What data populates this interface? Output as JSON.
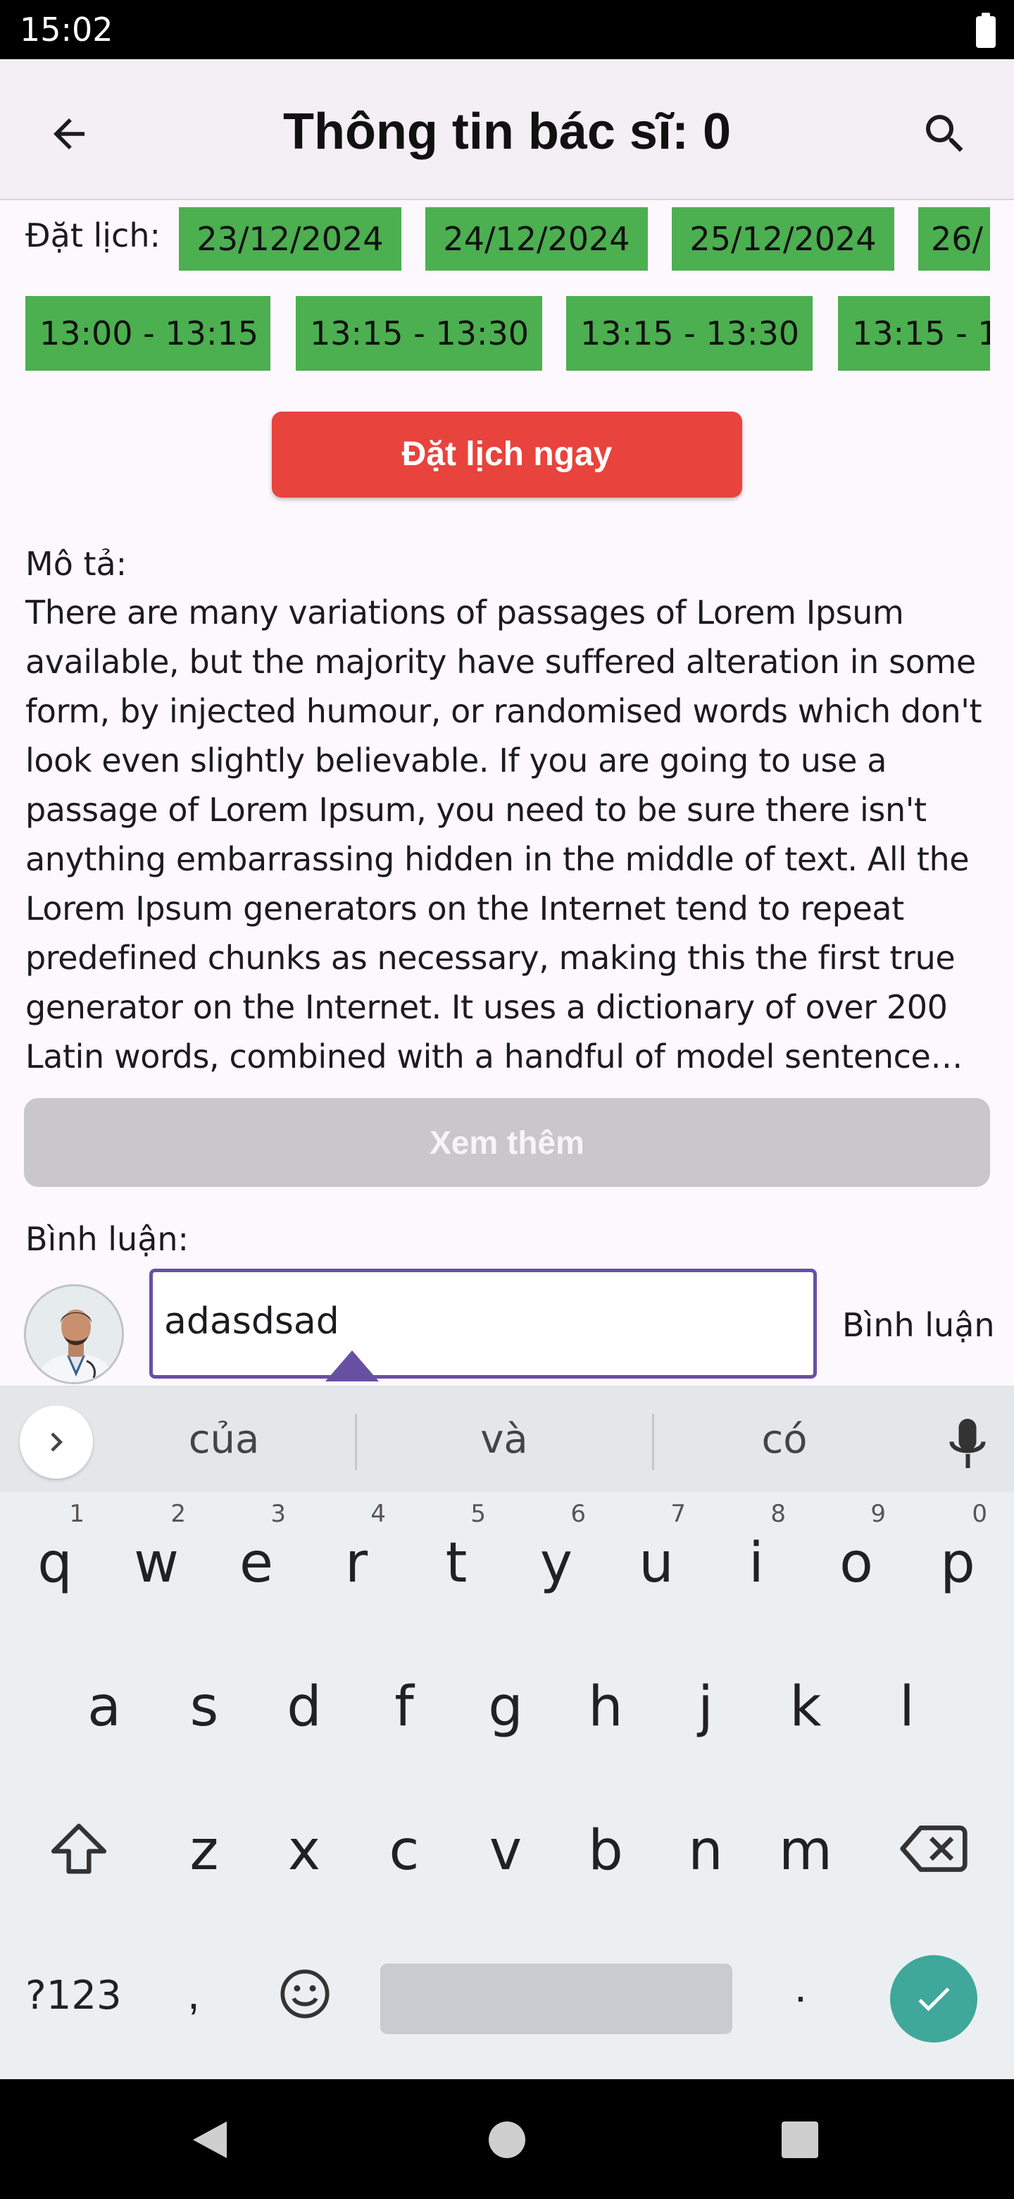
{
  "status_bar": {
    "time": "15:02",
    "battery_icon": "battery-full-icon"
  },
  "app_bar": {
    "title": "Thông tin bác sĩ: 0",
    "back_icon": "arrow-back-icon",
    "search_icon": "search-icon"
  },
  "booking": {
    "label": "Đặt lịch:",
    "dates": [
      "23/12/2024",
      "24/12/2024",
      "25/12/2024",
      "26/"
    ],
    "times": [
      "13:00 - 13:15",
      "13:15 - 13:30",
      "13:15 - 13:30",
      "13:15 - 1"
    ],
    "book_now_label": "Đặt lịch ngay",
    "chip_color": "#4caf50",
    "button_color": "#e8433d"
  },
  "description": {
    "label": "Mô tả:",
    "text": "There are many variations of passages of Lorem Ipsum available, but the majority have suffered alteration in some form, by injected humour, or randomised words which don't look even slightly believable. If you are going to use a passage of Lorem Ipsum, you need to be sure there isn't anything embarrassing hidden in the middle of text. All the Lorem Ipsum generators on the Internet tend to repeat predefined chunks as necessary, making this the first true generator on the Internet. It uses a dictionary of over 200 Latin words, combined with a handful of model sentence structures, to generate Lorem Ipsum which looks reasonable.",
    "see_more_label": "Xem thêm"
  },
  "comments": {
    "label": "Bình luận:",
    "input_value": "adasdsad",
    "submit_label": "Bình luận",
    "accent_color": "#6750a4"
  },
  "keyboard": {
    "suggestions": [
      "của",
      "và",
      "có"
    ],
    "row1": [
      {
        "letter": "q",
        "num": "1"
      },
      {
        "letter": "w",
        "num": "2"
      },
      {
        "letter": "e",
        "num": "3"
      },
      {
        "letter": "r",
        "num": "4"
      },
      {
        "letter": "t",
        "num": "5"
      },
      {
        "letter": "y",
        "num": "6"
      },
      {
        "letter": "u",
        "num": "7"
      },
      {
        "letter": "i",
        "num": "8"
      },
      {
        "letter": "o",
        "num": "9"
      },
      {
        "letter": "p",
        "num": "0"
      }
    ],
    "row2": [
      "a",
      "s",
      "d",
      "f",
      "g",
      "h",
      "j",
      "k",
      "l"
    ],
    "row3": [
      "z",
      "x",
      "c",
      "v",
      "b",
      "n",
      "m"
    ],
    "symbols_label": "?123",
    "comma": ",",
    "period": ".",
    "enter_color": "#3fa89b"
  },
  "nav_bar": {
    "back_icon": "nav-back-icon",
    "home_icon": "nav-home-icon",
    "recents_icon": "nav-recents-icon"
  }
}
